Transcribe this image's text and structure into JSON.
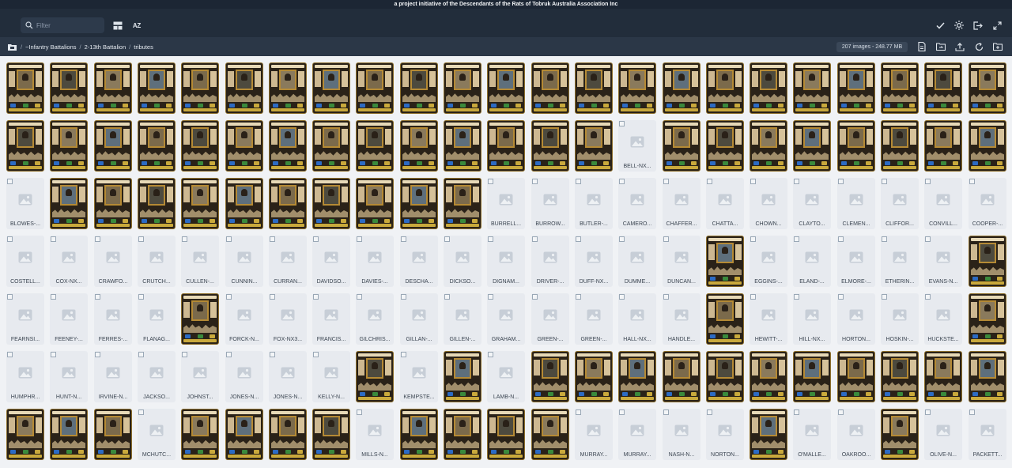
{
  "banner": {
    "text": "a project initiative of the Descendants of the Rats of Tobruk Australia Association Inc"
  },
  "toolbar": {
    "filter_placeholder": "Filter",
    "sort_label": "AZ",
    "icons": [
      "search-icon",
      "layout-icon",
      "sort-az-icon",
      "check-icon",
      "sun-icon",
      "logout-icon",
      "expand-icon"
    ]
  },
  "pathbar": {
    "crumbs": [
      "~Infantry Battalions",
      "2-13th Battalion",
      "tributes"
    ],
    "separator": "/",
    "count": "207 images - 248.77 MB",
    "icons": [
      "folder-icon",
      "document-icon",
      "folder-swap-icon",
      "upload-icon",
      "refresh-icon",
      "new-folder-icon"
    ]
  },
  "colors": {
    "banner_bg": "#1c2634",
    "toolbar_bg": "#222d3b",
    "pathbar_bg": "#2b3747",
    "grid_bg": "#f0f2f5",
    "placeholder_bg": "#e7eaef",
    "frame_gold": "#8d6f2d"
  },
  "grid": {
    "rows": [
      [
        "img",
        "img",
        "img",
        "img",
        "img",
        "img",
        "img",
        "img",
        "img",
        "img",
        "img",
        "img",
        "img",
        "img",
        "img",
        "img",
        "img",
        "img",
        "img",
        "img",
        "img",
        "img",
        "img"
      ],
      [
        "img",
        "img",
        "img",
        "img",
        "img",
        "img",
        "img",
        "img",
        "img",
        "img",
        "img",
        "img",
        "img",
        "img",
        "BELL-NX...",
        "img",
        "img",
        "img",
        "img",
        "img",
        "img",
        "img",
        "img"
      ],
      [
        "BLOWES-...",
        "img",
        "img",
        "img",
        "img",
        "img",
        "img",
        "img",
        "img",
        "img",
        "img",
        "BURRELL...",
        "BURROW...",
        "BUTLER-...",
        "CAMERO...",
        "CHAFFER...",
        "CHATTA...",
        "CHOWN...",
        "CLAYTO...",
        "CLEMEN...",
        "CLIFFOR...",
        "CONVILL...",
        "COOPER-..."
      ],
      [
        "COSTELL...",
        "COX-NX...",
        "CRAWFO...",
        "CRUTCH...",
        "CULLEN-...",
        "CUNNIN...",
        "CURRAN...",
        "DAVIDSO...",
        "DAVIES-...",
        "DESCHA...",
        "DICKSO...",
        "DIGNAM...",
        "DRIVER-...",
        "DUFF-NX...",
        "DUMME...",
        "DUNCAN...",
        "img",
        "EGGINS-...",
        "ELAND-...",
        "ELMORE-...",
        "ETHERIN...",
        "EVANS-N...",
        "img"
      ],
      [
        "FEARNSI...",
        "FEENEY-...",
        "FERRES-...",
        "FLANAG...",
        "img",
        "FORCK-N...",
        "FOX-NX3...",
        "FRANCIS...",
        "GILCHRIS...",
        "GILLAN-...",
        "GILLEN-...",
        "GRAHAM...",
        "GREEN-...",
        "GREEN-...",
        "HALL-NX...",
        "HANDLE...",
        "img",
        "HEWITT-...",
        "HILL-NX...",
        "HORTON...",
        "HOSKIN-...",
        "HUCKSTE...",
        "img"
      ],
      [
        "HUMPHR...",
        "HUNT-N...",
        "IRVINE-N...",
        "JACKSO...",
        "JOHNST...",
        "JONES-N...",
        "JONES-N...",
        "KELLY-N...",
        "img",
        "KEMPSTE...",
        "img",
        "LAMB-N...",
        "img",
        "img",
        "img",
        "img",
        "img",
        "img",
        "img",
        "img",
        "img",
        "img",
        "img"
      ],
      [
        "img",
        "img",
        "img",
        "MCHUTC...",
        "img",
        "img",
        "img",
        "img",
        "MILLS-N...",
        "img",
        "img",
        "img",
        "img",
        "MURRAY...",
        "MURRAY...",
        "NASH-N...",
        "NORTON...",
        "img",
        "O'MALLE...",
        "OAKROO...",
        "img",
        "OLIVE-N...",
        "PACKETT..."
      ]
    ]
  }
}
